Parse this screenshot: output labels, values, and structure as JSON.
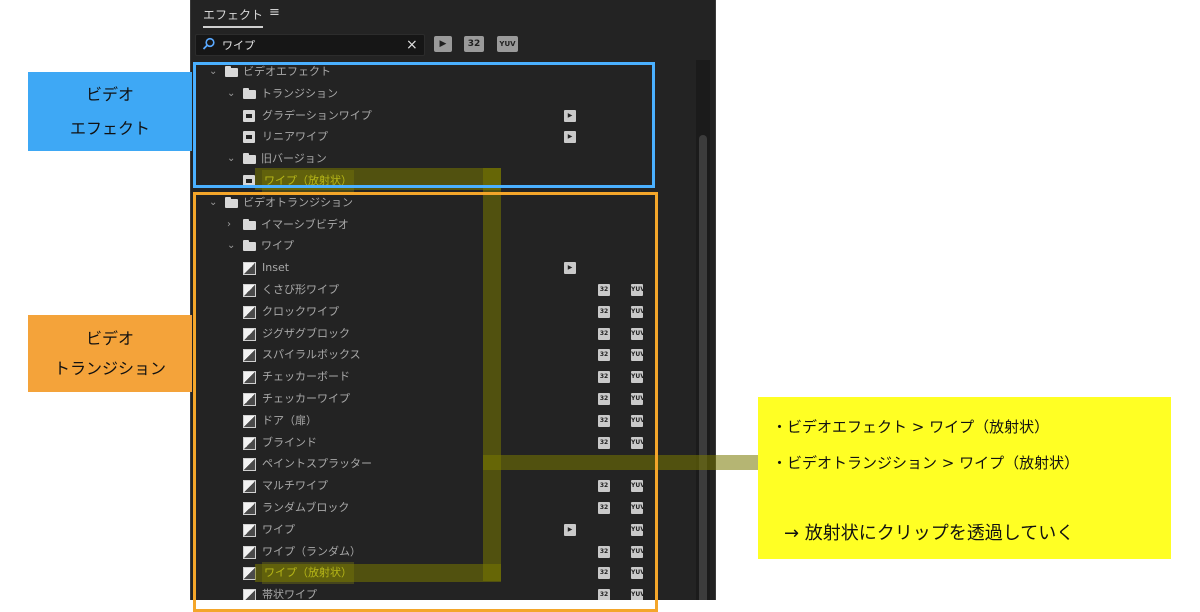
{
  "panel": {
    "title": "エフェクト",
    "menu_icon": "hamburger-icon",
    "search": {
      "value": "ワイプ",
      "placeholder": "",
      "icon": "search-icon",
      "clear": "×"
    },
    "toolbar": [
      {
        "name": "accelerated-effects-filter",
        "text": "",
        "icon": "accelerated-effect-icon"
      },
      {
        "name": "32bit-filter",
        "text": "32",
        "icon": "32bit-icon"
      },
      {
        "name": "yuv-filter",
        "text": "YUV",
        "icon": "yuv-icon"
      }
    ],
    "tree": [
      {
        "label": "ビデオエフェクト",
        "kind": "folder",
        "depth": 0,
        "expanded": true,
        "badges": []
      },
      {
        "label": "トランジション",
        "kind": "folder",
        "depth": 1,
        "expanded": true,
        "badges": []
      },
      {
        "label": "グラデーションワイプ",
        "kind": "effect",
        "depth": 2,
        "badges": [
          "accel"
        ]
      },
      {
        "label": "リニアワイプ",
        "kind": "effect",
        "depth": 2,
        "badges": [
          "accel"
        ]
      },
      {
        "label": "旧バージョン",
        "kind": "folder",
        "depth": 1,
        "expanded": true,
        "badges": []
      },
      {
        "label": "ワイプ（放射状）",
        "kind": "effect",
        "depth": 2,
        "badges": [],
        "highlight": true
      },
      {
        "label": "ビデオトランジション",
        "kind": "folder",
        "depth": 0,
        "expanded": true,
        "badges": []
      },
      {
        "label": "イマーシブビデオ",
        "kind": "folder",
        "depth": 1,
        "expanded": false,
        "badges": []
      },
      {
        "label": "ワイプ",
        "kind": "folder",
        "depth": 1,
        "expanded": true,
        "badges": []
      },
      {
        "label": "Inset",
        "kind": "transition",
        "depth": 2,
        "badges": [
          "accel"
        ]
      },
      {
        "label": "くさび形ワイプ",
        "kind": "transition",
        "depth": 2,
        "badges": [
          "32",
          "yuv"
        ]
      },
      {
        "label": "クロックワイプ",
        "kind": "transition",
        "depth": 2,
        "badges": [
          "32",
          "yuv"
        ]
      },
      {
        "label": "ジグザグブロック",
        "kind": "transition",
        "depth": 2,
        "badges": [
          "32",
          "yuv"
        ]
      },
      {
        "label": "スパイラルボックス",
        "kind": "transition",
        "depth": 2,
        "badges": [
          "32",
          "yuv"
        ]
      },
      {
        "label": "チェッカーボード",
        "kind": "transition",
        "depth": 2,
        "badges": [
          "32",
          "yuv"
        ]
      },
      {
        "label": "チェッカーワイプ",
        "kind": "transition",
        "depth": 2,
        "badges": [
          "32",
          "yuv"
        ]
      },
      {
        "label": "ドア（扉）",
        "kind": "transition",
        "depth": 2,
        "badges": [
          "32",
          "yuv"
        ]
      },
      {
        "label": "ブラインド",
        "kind": "transition",
        "depth": 2,
        "badges": [
          "32",
          "yuv"
        ]
      },
      {
        "label": "ペイントスプラッター",
        "kind": "transition",
        "depth": 2,
        "badges": []
      },
      {
        "label": "マルチワイプ",
        "kind": "transition",
        "depth": 2,
        "badges": [
          "32",
          "yuv"
        ]
      },
      {
        "label": "ランダムブロック",
        "kind": "transition",
        "depth": 2,
        "badges": [
          "32",
          "yuv"
        ]
      },
      {
        "label": "ワイプ",
        "kind": "transition",
        "depth": 2,
        "badges": [
          "accel",
          "yuv"
        ]
      },
      {
        "label": "ワイプ（ランダム）",
        "kind": "transition",
        "depth": 2,
        "badges": [
          "32",
          "yuv"
        ]
      },
      {
        "label": "ワイプ（放射状）",
        "kind": "transition",
        "depth": 2,
        "badges": [
          "32",
          "yuv"
        ],
        "highlight": true
      },
      {
        "label": "帯状ワイプ",
        "kind": "transition",
        "depth": 2,
        "badges": [
          "32",
          "yuv"
        ]
      }
    ]
  },
  "callouts": {
    "effects": {
      "line1": "ビデオ",
      "line2": "エフェクト",
      "color": "#3ea8f5"
    },
    "transitions": {
      "line1": "ビデオ",
      "line2": "トランジション",
      "color": "#f4a33a"
    }
  },
  "note": {
    "line1": "・ビデオエフェクト > ワイプ（放射状）",
    "line2": "・ビデオトランジション > ワイプ（放射状）",
    "conclusion": "→ 放射状にクリップを透過していく",
    "color": "#ffff24"
  },
  "colors": {
    "panel_bg": "#232323",
    "effects_outline": "#4ab0ff",
    "transitions_outline": "#f4a62a",
    "highlight_text": "#ffff33"
  }
}
